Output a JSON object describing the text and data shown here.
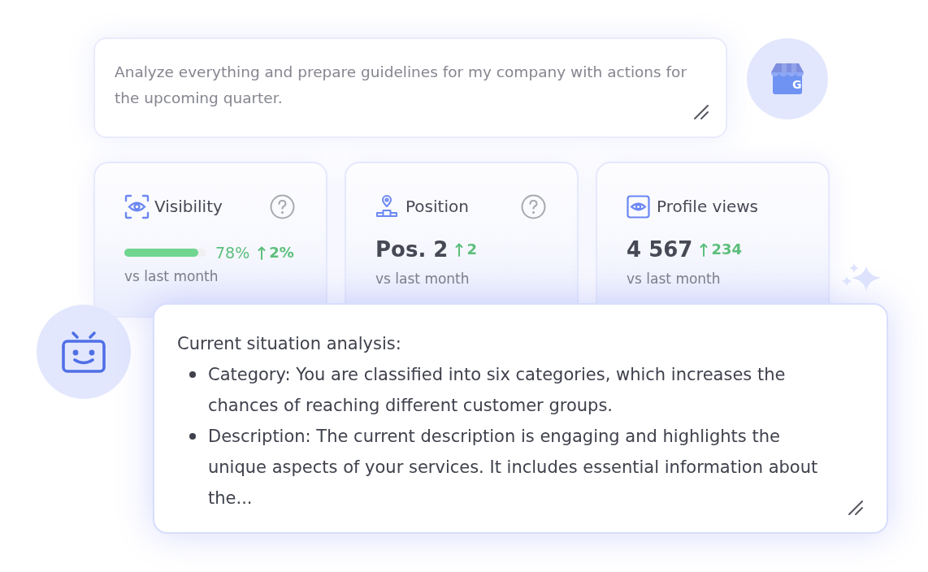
{
  "prompt": {
    "placeholder": "Analyze everything and prepare guidelines for my company with actions for the upcoming quarter."
  },
  "business_logo": {
    "letter": "G"
  },
  "stats": [
    {
      "kind": "progress",
      "title": "Visibility",
      "has_help": true,
      "level": 0.9,
      "value": "78%",
      "change": "2%",
      "caption": "vs last month"
    },
    {
      "kind": "number",
      "title": "Position",
      "has_help": true,
      "value": "Pos. 2",
      "change": "2",
      "caption": "vs last month"
    },
    {
      "kind": "number",
      "title": "Profile views",
      "has_help": false,
      "value": "4 567",
      "change": "234",
      "caption": "vs last month"
    }
  ],
  "response": {
    "heading": "Current situation analysis:",
    "bullets": [
      "Category: You are classified into six categories, which increases the chances of reaching different customer groups.",
      "Description: The current description is engaging and highlights the unique aspects of your services. It includes essential information about the..."
    ]
  }
}
